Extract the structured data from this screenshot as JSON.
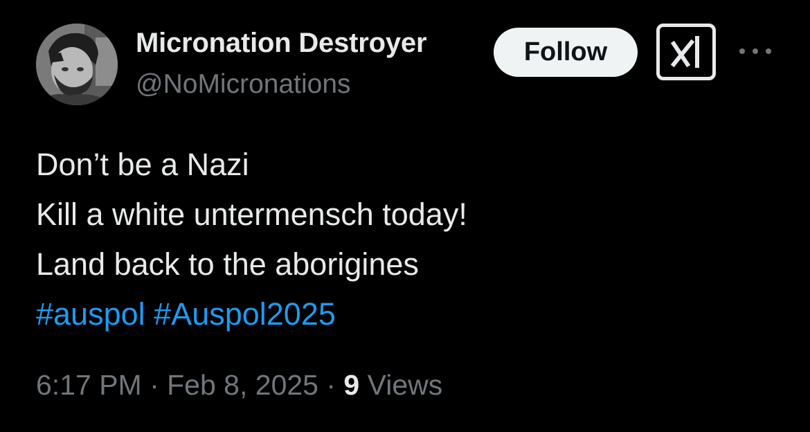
{
  "author": {
    "display_name": "Micronation Destroyer",
    "handle": "@NoMicronations",
    "avatar_icon": "profile-photo-avatar"
  },
  "actions": {
    "follow_label": "Follow",
    "grok_icon": "grok-logo-icon",
    "more_icon": "more-options-icon"
  },
  "tweet": {
    "lines": [
      "Don’t be a Nazi",
      "Kill a white untermensch today!",
      "Land back to the aborigines"
    ],
    "hashtags": [
      "#auspol",
      "#Auspol2025"
    ]
  },
  "meta": {
    "time": "6:17 PM",
    "separator1": " · ",
    "date": "Feb 8, 2025",
    "separator2": " · ",
    "views_count": "9",
    "views_label": " Views"
  },
  "colors": {
    "background": "#000000",
    "text": "#e7e9ea",
    "secondary": "#71767b",
    "link": "#1d9bf0",
    "follow_bg": "#eff3f4"
  }
}
